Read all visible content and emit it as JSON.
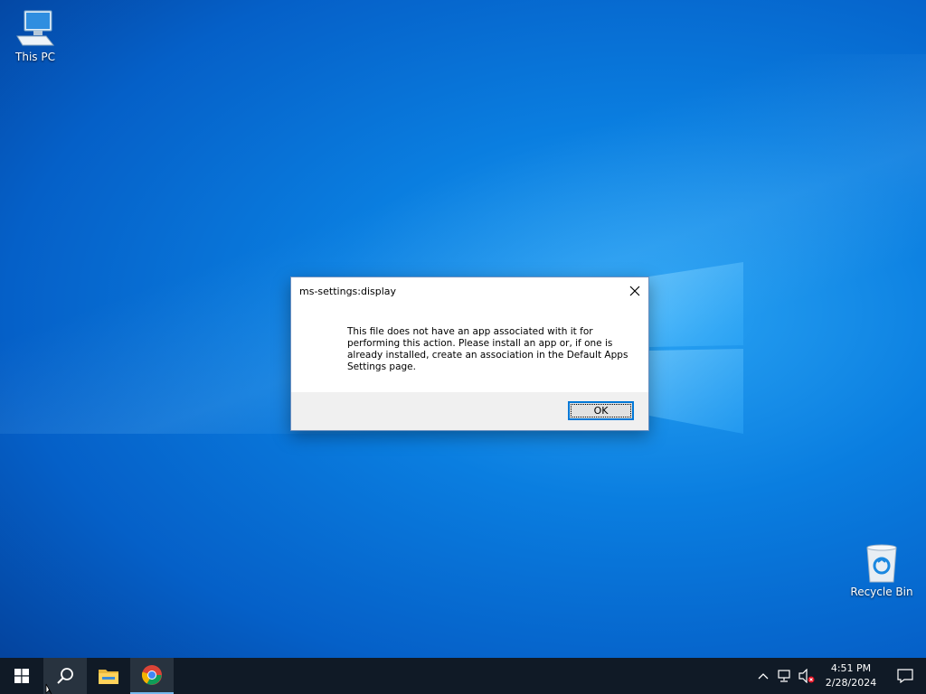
{
  "desktop": {
    "icons": [
      {
        "label": "This PC",
        "icon": "computer-icon"
      },
      {
        "label": "Recycle Bin",
        "icon": "recycle-bin-icon"
      }
    ]
  },
  "dialog": {
    "title": "ms-settings:display",
    "message": "This file does not have an app associated with it for performing this action. Please install an app or, if one is already installed, create an association in the Default Apps Settings page.",
    "ok_label": "OK",
    "close_icon": "close-icon"
  },
  "taskbar": {
    "start_icon": "windows-start-icon",
    "search_icon": "search-icon",
    "pinned": [
      {
        "name": "File Explorer",
        "icon": "folder-icon"
      },
      {
        "name": "Google Chrome",
        "icon": "chrome-icon"
      }
    ],
    "tray": {
      "icons": [
        "chevron-up-icon",
        "network-icon",
        "volume-muted-icon"
      ],
      "time": "4:51 PM",
      "date": "2/28/2024",
      "notification_icon": "notification-icon"
    }
  },
  "colors": {
    "accent": "#0078d7",
    "taskbar": "#101a26",
    "desktop": "#0a7ee0"
  }
}
